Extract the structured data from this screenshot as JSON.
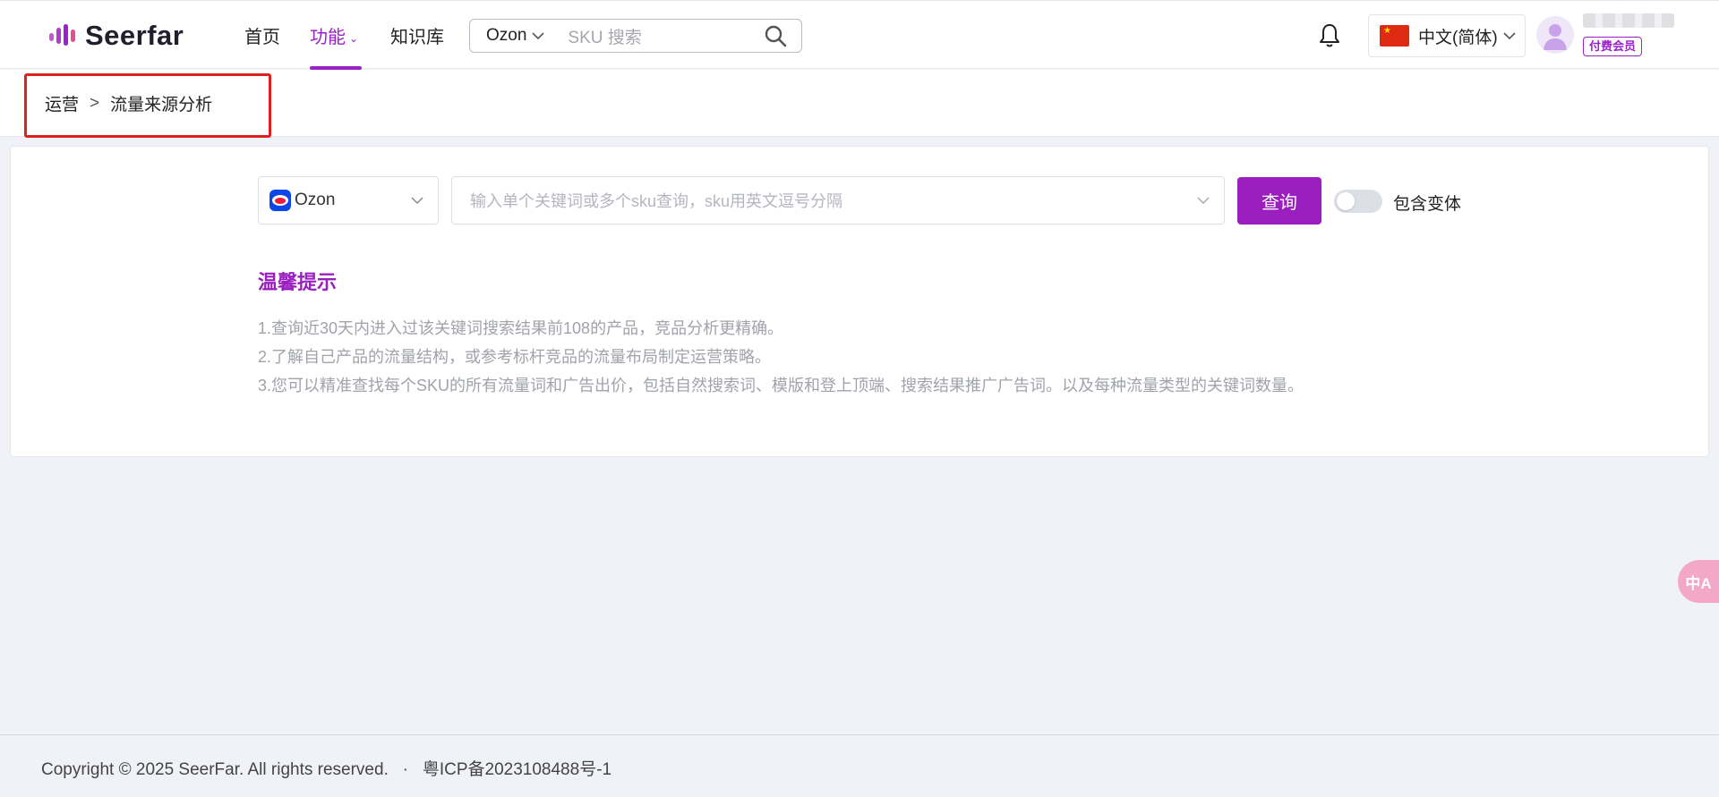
{
  "header": {
    "logo_text": "Seerfar",
    "nav": [
      {
        "label": "首页"
      },
      {
        "label": "功能",
        "active": true
      },
      {
        "label": "知识库"
      }
    ],
    "search": {
      "platform": "Ozon",
      "placeholder": "SKU 搜索"
    },
    "language": "中文(简体)",
    "member_badge": "付费会员"
  },
  "breadcrumb": {
    "items": [
      "运营",
      "流量来源分析"
    ],
    "separator": ">"
  },
  "query": {
    "platform": "Ozon",
    "input_placeholder": "输入单个关键词或多个sku查询，sku用英文逗号分隔",
    "button_label": "查询",
    "toggle_label": "包含变体",
    "toggle_on": false
  },
  "tips": {
    "title": "温馨提示",
    "items": [
      "1.查询近30天内进入过该关键词搜索结果前108的产品，竞品分析更精确。",
      "2.了解自己产品的流量结构，或参考标杆竞品的流量布局制定运营策略。",
      "3.您可以精准查找每个SKU的所有流量词和广告出价，包括自然搜索词、模版和登上顶端、搜索结果推广广告词。以及每种流量类型的关键词数量。"
    ]
  },
  "footer": {
    "text": "Copyright © 2025 SeerFar. All rights reserved.   ·   粤ICP备2023108488号-1"
  },
  "float_button": "中A",
  "colors": {
    "accent": "#9b1fbf",
    "highlight_border": "#e0201c",
    "background": "#f0f2f7"
  }
}
